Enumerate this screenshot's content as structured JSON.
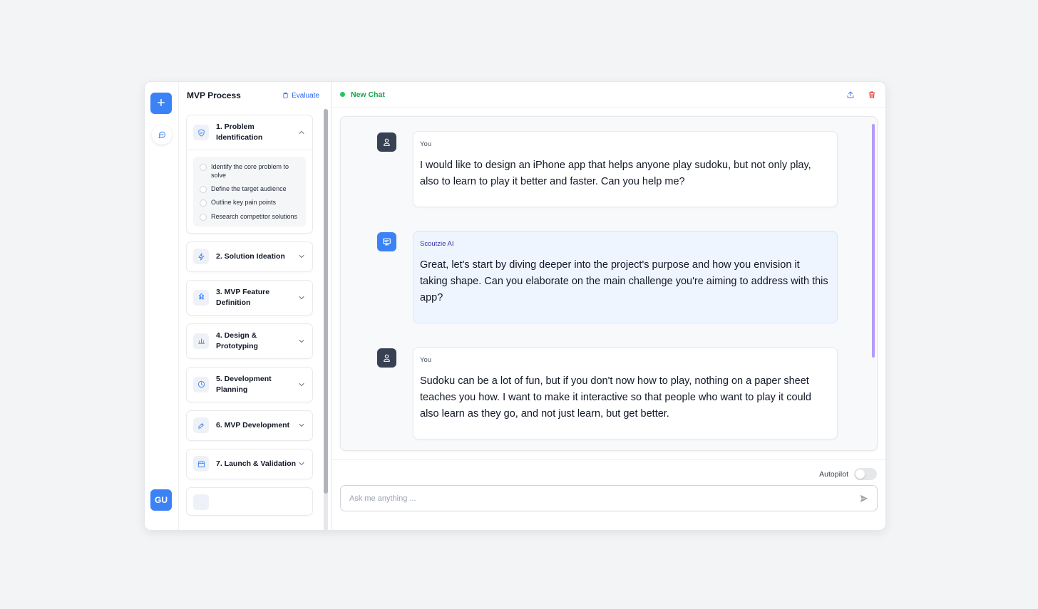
{
  "rail": {
    "add_label": "+",
    "avatar_initials": "GU"
  },
  "panel": {
    "title": "MVP Process",
    "evaluate_label": "Evaluate",
    "steps": [
      {
        "label": "1. Problem Identification",
        "icon": "shield-icon",
        "expanded": true,
        "tasks": [
          "Identify the core problem to solve",
          "Define the target audience",
          "Outline key pain points",
          "Research competitor solutions"
        ]
      },
      {
        "label": "2. Solution Ideation",
        "icon": "lightning-icon",
        "expanded": false
      },
      {
        "label": "3. MVP Feature Definition",
        "icon": "puzzle-icon",
        "expanded": false
      },
      {
        "label": "4. Design & Prototyping",
        "icon": "bar-chart-icon",
        "expanded": false
      },
      {
        "label": "5. Development Planning",
        "icon": "clock-icon",
        "expanded": false
      },
      {
        "label": "6. MVP Development",
        "icon": "edit-icon",
        "expanded": false
      },
      {
        "label": "7. Launch & Validation",
        "icon": "calendar-icon",
        "expanded": false
      }
    ]
  },
  "chat": {
    "title": "New Chat",
    "messages": [
      {
        "sender": "You",
        "role": "user",
        "text": "I would like to design an iPhone app that helps anyone play sudoku, but not only play, also to learn to play it better and faster. Can you help me?"
      },
      {
        "sender": "Scoutzie AI",
        "role": "ai",
        "text": "Great, let's start by diving deeper into the project's purpose and how you envision it taking shape. Can you elaborate on the main challenge you're aiming to address with this app?"
      },
      {
        "sender": "You",
        "role": "user",
        "text": "Sudoku can be a lot of fun, but if you don't now how to play, nothing on a paper sheet teaches you how. I want to make it interactive so that people who want to play it could also learn as they go, and not just learn, but get better."
      }
    ],
    "autopilot_label": "Autopilot",
    "autopilot_on": false,
    "input_placeholder": "Ask me anything ...",
    "input_value": ""
  },
  "colors": {
    "accent": "#3b82f6",
    "status_online": "#22c55e",
    "evaluate_link": "#2563eb",
    "delete": "#dc2626",
    "ai_bubble": "#eff5fe"
  }
}
